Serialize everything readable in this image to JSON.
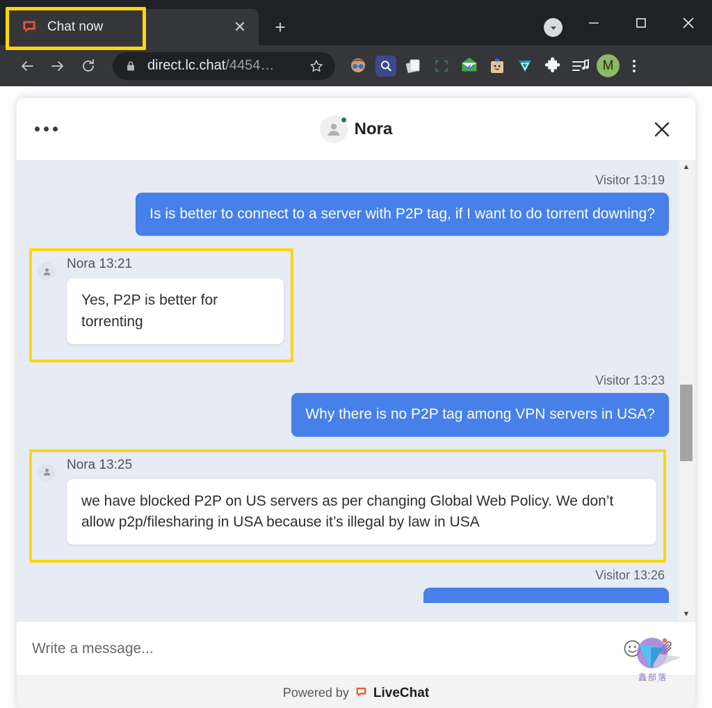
{
  "browser": {
    "tab": {
      "title": "Chat now",
      "favicon": "livechat-speech-bubble-icon",
      "close_label": "✕"
    },
    "new_tab_label": "+",
    "window_controls": {
      "minimize": "—",
      "maximize": "☐",
      "close": "✕"
    },
    "download_chip": "chevron-down-icon",
    "nav": {
      "back": "←",
      "forward": "→",
      "reload": "↻"
    },
    "omnibox": {
      "lock": "lock-icon",
      "url_main": "direct.lc.chat",
      "url_dim": "/4454…",
      "bookmark": "☆"
    },
    "extensions": [
      {
        "name": "extension-face-glasses",
        "glyph": "🧑",
        "bg": "transparent"
      },
      {
        "name": "extension-search-magnifier",
        "glyph": "🔍",
        "bg": "#3b4a8c"
      },
      {
        "name": "extension-pages",
        "glyph": "🗒",
        "bg": "transparent"
      },
      {
        "name": "extension-capture-frame",
        "glyph": "⬚",
        "bg": "transparent"
      },
      {
        "name": "extension-mail-check",
        "glyph": "✉",
        "bg": "transparent"
      },
      {
        "name": "extension-clipboard-face",
        "glyph": "🗂",
        "bg": "transparent"
      },
      {
        "name": "extension-triangle-drop",
        "glyph": "▽",
        "bg": "transparent"
      },
      {
        "name": "extension-puzzle-piece",
        "glyph": "🧩",
        "bg": "transparent"
      },
      {
        "name": "extension-playlist-music",
        "glyph": "♫",
        "bg": "transparent"
      }
    ],
    "profile_initial": "M",
    "menu": "kebab-menu-icon"
  },
  "chat": {
    "header": {
      "menu_icon": "ellipsis-icon",
      "agent_name": "Nora",
      "status": "online",
      "close_icon": "close-icon"
    },
    "messages": [
      {
        "id": "m1",
        "side": "visitor",
        "meta": "Visitor 13:19",
        "text": "Is is better to connect to a server with P2P tag, if I want to do torrent downing?",
        "highlighted": false
      },
      {
        "id": "m2",
        "side": "agent",
        "meta": "Nora 13:21",
        "text": "Yes, P2P is better for torrenting",
        "highlighted": true
      },
      {
        "id": "m3",
        "side": "visitor",
        "meta": "Visitor 13:23",
        "text": "Why there is no P2P tag among VPN servers in USA?",
        "highlighted": false
      },
      {
        "id": "m4",
        "side": "agent",
        "meta": "Nora 13:25",
        "text": "we have blocked P2P on US servers as per changing Global Web Policy. We don’t allow p2p/filesharing in USA because it’s illegal by law in USA",
        "highlighted": true
      },
      {
        "id": "m5",
        "side": "visitor",
        "meta": "Visitor 13:26",
        "text": "",
        "highlighted": false,
        "partial": true
      }
    ],
    "scrollbar": {
      "up_arrow": "▲",
      "down_arrow": "▼"
    },
    "composer": {
      "placeholder": "Write a message...",
      "value": "",
      "emoji_icon": "smiley-icon",
      "attach_icon": "paperclip-icon"
    },
    "footer": {
      "powered_by": "Powered by",
      "brand": "LiveChat",
      "brand_icon": "livechat-speech-bubble-icon"
    }
  },
  "watermark": {
    "text": "鑫部落"
  },
  "colors": {
    "highlight": "#ffd60a",
    "visitor_bubble": "#4680e8",
    "chat_background": "#e7ebf5",
    "online_dot": "#0a8a3c",
    "brand_orange": "#e4572e",
    "browser_chrome": "#35363a",
    "titlebar": "#202124"
  }
}
